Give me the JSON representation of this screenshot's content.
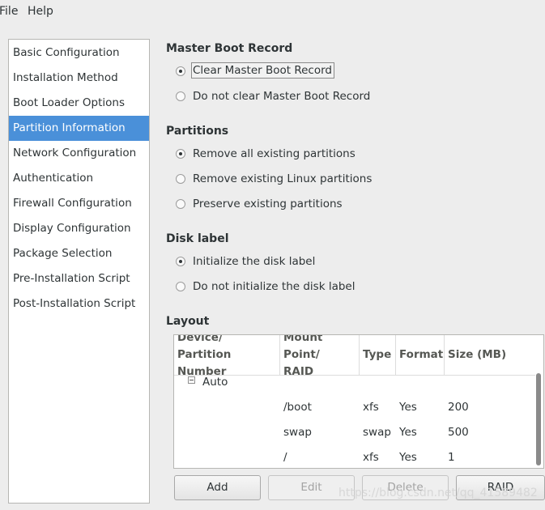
{
  "menubar": {
    "file": "File",
    "help": "Help"
  },
  "sidebar": {
    "items": [
      {
        "label": "Basic Configuration"
      },
      {
        "label": "Installation Method"
      },
      {
        "label": "Boot Loader Options"
      },
      {
        "label": "Partition Information",
        "selected": true
      },
      {
        "label": "Network Configuration"
      },
      {
        "label": "Authentication"
      },
      {
        "label": "Firewall Configuration"
      },
      {
        "label": "Display Configuration"
      },
      {
        "label": "Package Selection"
      },
      {
        "label": "Pre-Installation Script"
      },
      {
        "label": "Post-Installation Script"
      }
    ]
  },
  "mbr": {
    "title": "Master Boot Record",
    "options": [
      {
        "label": "Clear Master Boot Record",
        "checked": true
      },
      {
        "label": "Do not clear Master Boot Record",
        "checked": false
      }
    ]
  },
  "partitions": {
    "title": "Partitions",
    "options": [
      {
        "label": "Remove all existing partitions",
        "checked": true
      },
      {
        "label": "Remove existing Linux partitions",
        "checked": false
      },
      {
        "label": "Preserve existing partitions",
        "checked": false
      }
    ]
  },
  "disklabel": {
    "title": "Disk label",
    "options": [
      {
        "label": "Initialize the disk label",
        "checked": true
      },
      {
        "label": "Do not initialize the disk label",
        "checked": false
      }
    ]
  },
  "layout": {
    "title": "Layout",
    "headers": {
      "device_1": "Device/",
      "device_2": "Partition Number",
      "mount_1": "Mount Point/",
      "mount_2": "RAID",
      "type": "Type",
      "format": "Format",
      "size": "Size (MB)"
    },
    "group": "Auto",
    "rows": [
      {
        "mount": "/boot",
        "type": "xfs",
        "format": "Yes",
        "size": "200"
      },
      {
        "mount": "swap",
        "type": "swap",
        "format": "Yes",
        "size": "500"
      },
      {
        "mount": "/",
        "type": "xfs",
        "format": "Yes",
        "size": "1"
      }
    ]
  },
  "buttons": {
    "add": "Add",
    "edit": "Edit",
    "delete": "Delete",
    "raid": "RAID"
  },
  "watermark": "https://blog.csdn.net/qq_41589482"
}
